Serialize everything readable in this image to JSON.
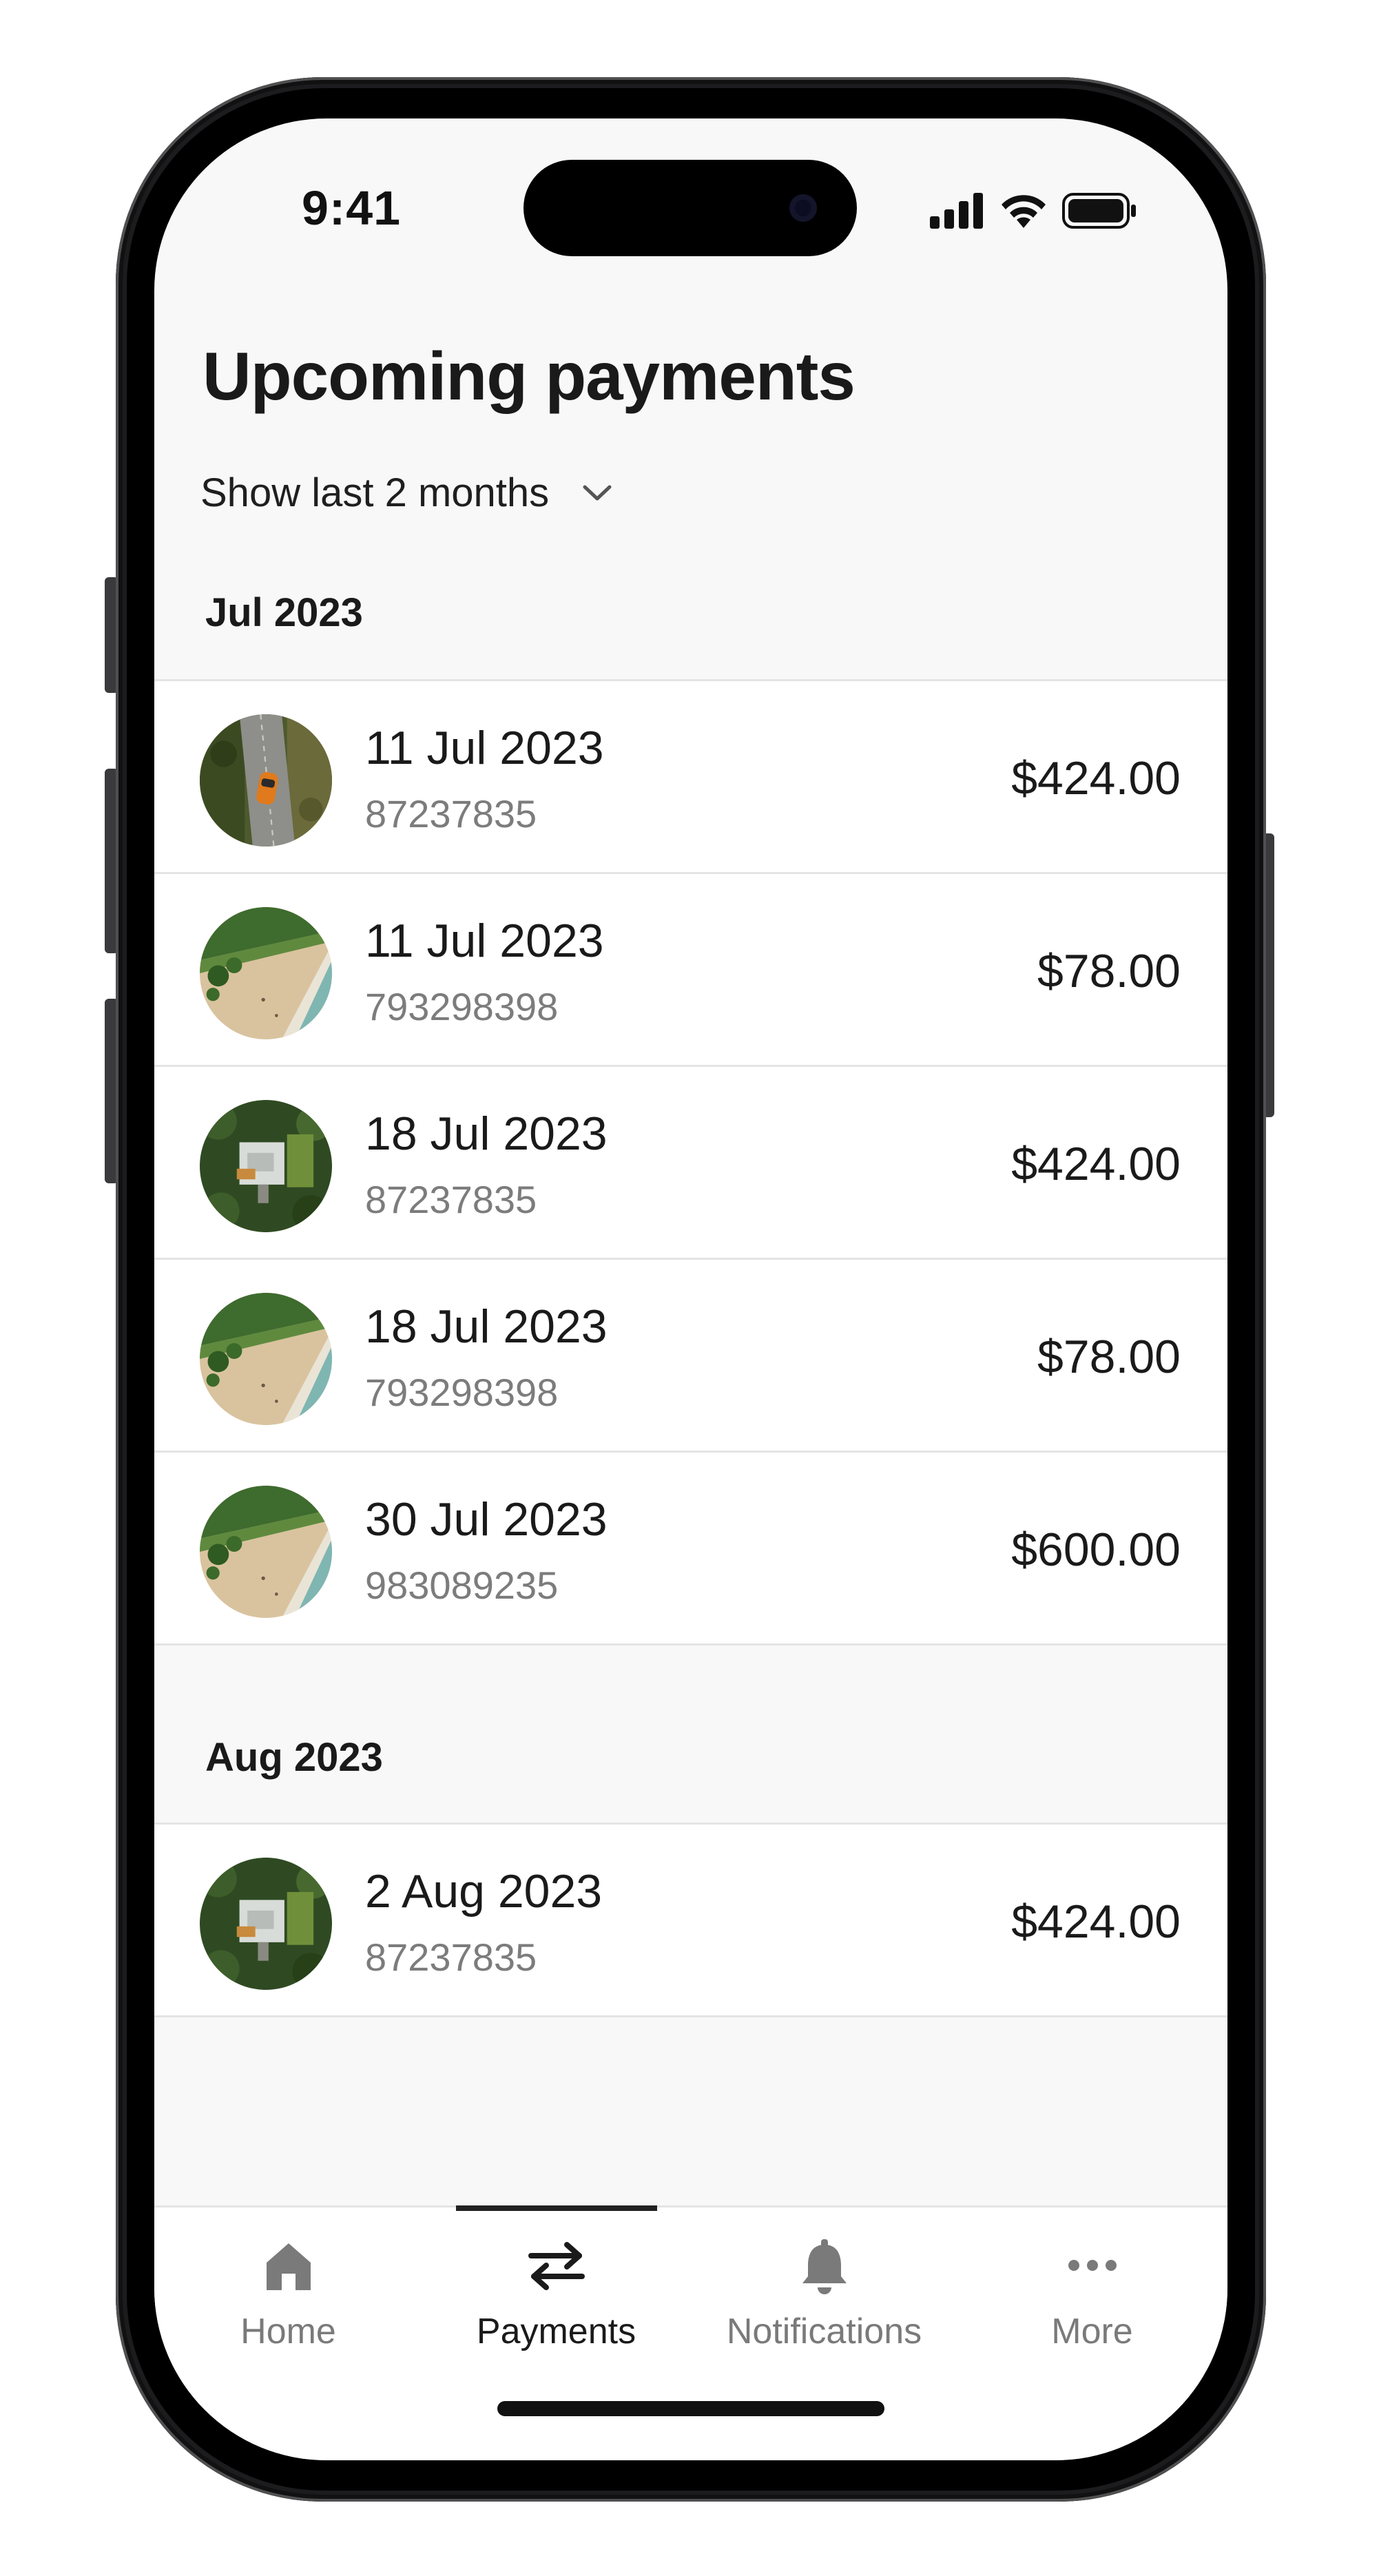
{
  "status_bar": {
    "time": "9:41"
  },
  "header": {
    "title": "Upcoming payments",
    "filter_label": "Show last 2 months",
    "filter_icon": "chevron-down-icon"
  },
  "groups": [
    {
      "heading": "Jul 2023",
      "rows": [
        {
          "date": "11 Jul 2023",
          "reference": "87237835",
          "amount": "$424.00",
          "thumbnail": "car-on-road"
        },
        {
          "date": "11 Jul 2023",
          "reference": "793298398",
          "amount": "$78.00",
          "thumbnail": "beach"
        },
        {
          "date": "18 Jul 2023",
          "reference": "87237835",
          "amount": "$424.00",
          "thumbnail": "house-in-trees"
        },
        {
          "date": "18 Jul 2023",
          "reference": "793298398",
          "amount": "$78.00",
          "thumbnail": "beach"
        },
        {
          "date": "30 Jul 2023",
          "reference": "983089235",
          "amount": "$600.00",
          "thumbnail": "beach"
        }
      ]
    },
    {
      "heading": "Aug 2023",
      "rows": [
        {
          "date": "2 Aug 2023",
          "reference": "87237835",
          "amount": "$424.00",
          "thumbnail": "house-in-trees"
        }
      ]
    }
  ],
  "tabbar": {
    "tabs": [
      {
        "label": "Home",
        "icon": "home-icon",
        "active": false
      },
      {
        "label": "Payments",
        "icon": "transfer-arrows-icon",
        "active": true
      },
      {
        "label": "Notifications",
        "icon": "bell-icon",
        "active": false
      },
      {
        "label": "More",
        "icon": "more-dots-icon",
        "active": false
      }
    ]
  },
  "colors": {
    "screen_background": "#f8f8f8",
    "list_background": "#ffffff",
    "primary_text": "#1a1a1a",
    "secondary_text": "#7c7c7c",
    "inactive_tab": "#7a7a7a",
    "divider": "#e4e4e4"
  }
}
